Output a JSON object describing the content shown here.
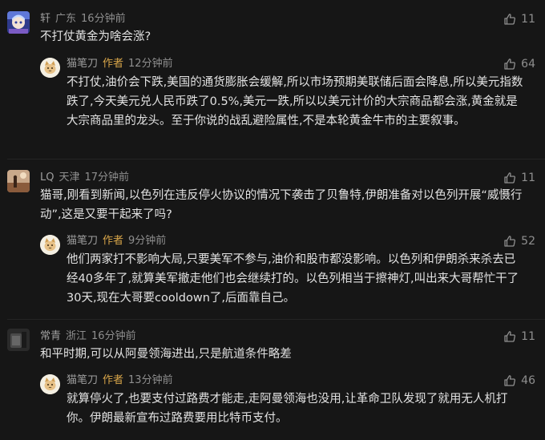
{
  "comments": [
    {
      "name": "轩",
      "location": "广东",
      "time": "16分钟前",
      "likes": "11",
      "text": "不打仗黄金为啥会涨?",
      "reply": {
        "name": "猫笔刀",
        "badge": "作者",
        "time": "12分钟前",
        "likes": "64",
        "text": "不打仗,油价会下跌,美国的通货膨胀会缓解,所以市场预期美联储后面会降息,所以美元指数跌了,今天美元兑人民币跌了0.5%,美元一跌,所以以美元计价的大宗商品都会涨,黄金就是大宗商品里的龙头。至于你说的战乱避险属性,不是本轮黄金牛市的主要叙事。"
      }
    },
    {
      "name": "LQ",
      "location": "天津",
      "time": "17分钟前",
      "likes": "11",
      "text": "猫哥,刚看到新闻,以色列在违反停火协议的情况下袭击了贝鲁特,伊朗准备对以色列开展“威慑行动”,这是又要干起来了吗?",
      "reply": {
        "name": "猫笔刀",
        "badge": "作者",
        "time": "9分钟前",
        "likes": "52",
        "text": "他们两家打不影响大局,只要美军不参与,油价和股市都没影响。以色列和伊朗杀来杀去已经40多年了,就算美军撤走他们也会继续打的。以色列相当于擦神灯,叫出来大哥帮忙干了30天,现在大哥要cooldown了,后面靠自己。"
      }
    },
    {
      "name": "常青",
      "location": "浙江",
      "time": "16分钟前",
      "likes": "11",
      "text": "和平时期,可以从阿曼领海进出,只是航道条件略差",
      "reply": {
        "name": "猫笔刀",
        "badge": "作者",
        "time": "13分钟前",
        "likes": "46",
        "text": "就算停火了,也要支付过路费才能走,走阿曼领海也没用,让革命卫队发现了就用无人机打你。伊朗最新宣布过路费要用比特币支付。"
      }
    }
  ],
  "icons": {
    "like": "thumbs-up-icon"
  },
  "colors": {
    "background": "#161616",
    "author_badge": "#d9a64a",
    "meta": "#8f8f8f",
    "text": "#e2e2e2"
  }
}
